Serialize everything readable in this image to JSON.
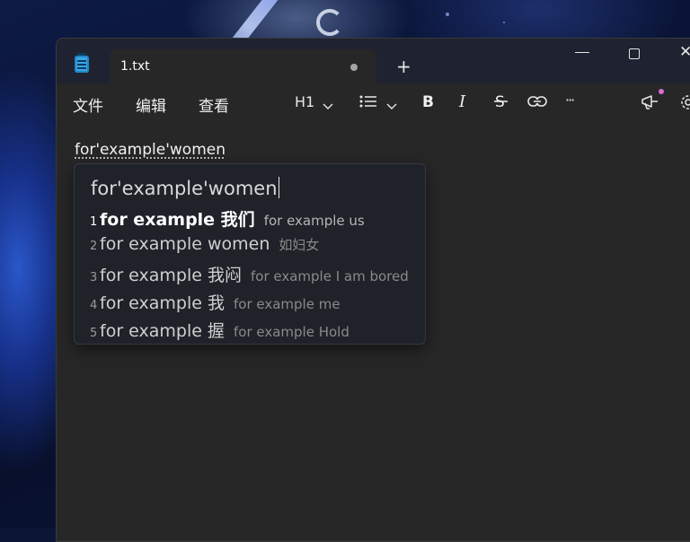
{
  "window": {
    "tab_title": "1.txt",
    "new_tab": "+",
    "controls": {
      "close": "✕"
    }
  },
  "toolbar": {
    "menus": [
      "文件",
      "编辑",
      "查看"
    ],
    "heading": "H1",
    "icons": [
      "list-icon",
      "bold-icon",
      "italic-icon",
      "strikethrough-icon",
      "link-icon",
      "more-icon",
      "announcement-icon",
      "settings-icon"
    ],
    "more": "···"
  },
  "document": {
    "text": "for'example'women"
  },
  "ime": {
    "composition": "for'example'women",
    "candidates": [
      {
        "num": "1",
        "word": "for example 我们",
        "translation": "for example us"
      },
      {
        "num": "2",
        "word": "for example women",
        "translation": "如妇女"
      },
      {
        "num": "3",
        "word": "for example 我闷",
        "translation": "for example I am bored"
      },
      {
        "num": "4",
        "word": "for example 我",
        "translation": "for example me"
      },
      {
        "num": "5",
        "word": "for example 握",
        "translation": "for example Hold"
      }
    ]
  },
  "colors": {
    "editor_bg": "#272727",
    "titlebar_bg": "#1f2230",
    "ime_bg": "#1f2229",
    "notification_badge": "#d96bd0"
  }
}
